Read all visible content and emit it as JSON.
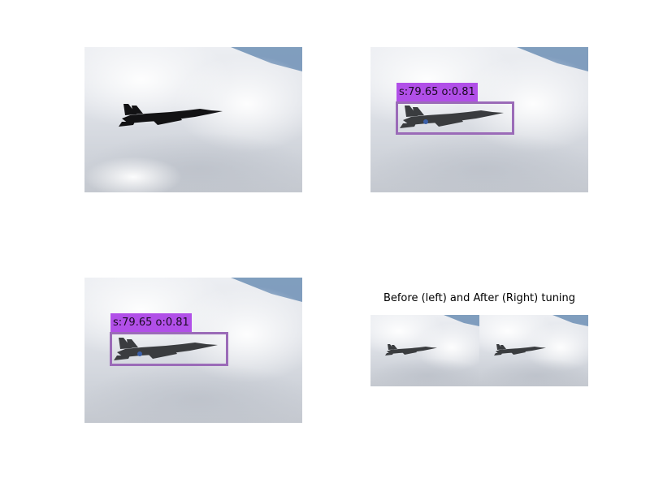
{
  "panels": {
    "top_left": {
      "content": "fighter jet silhouette against cloudy sky"
    },
    "top_right": {
      "detection": {
        "label": "s:79.65 o:0.81"
      }
    },
    "bottom_left": {
      "detection": {
        "label": "s:79.65 o:0.81"
      }
    },
    "bottom_right": {
      "title": "Before (left) and After (Right) tuning"
    }
  },
  "colors": {
    "box_border": "#9b6bb8",
    "label_bg": "#b14fe8",
    "sky": "#dfe2e8",
    "blue_sky": "#6d8fb5"
  }
}
